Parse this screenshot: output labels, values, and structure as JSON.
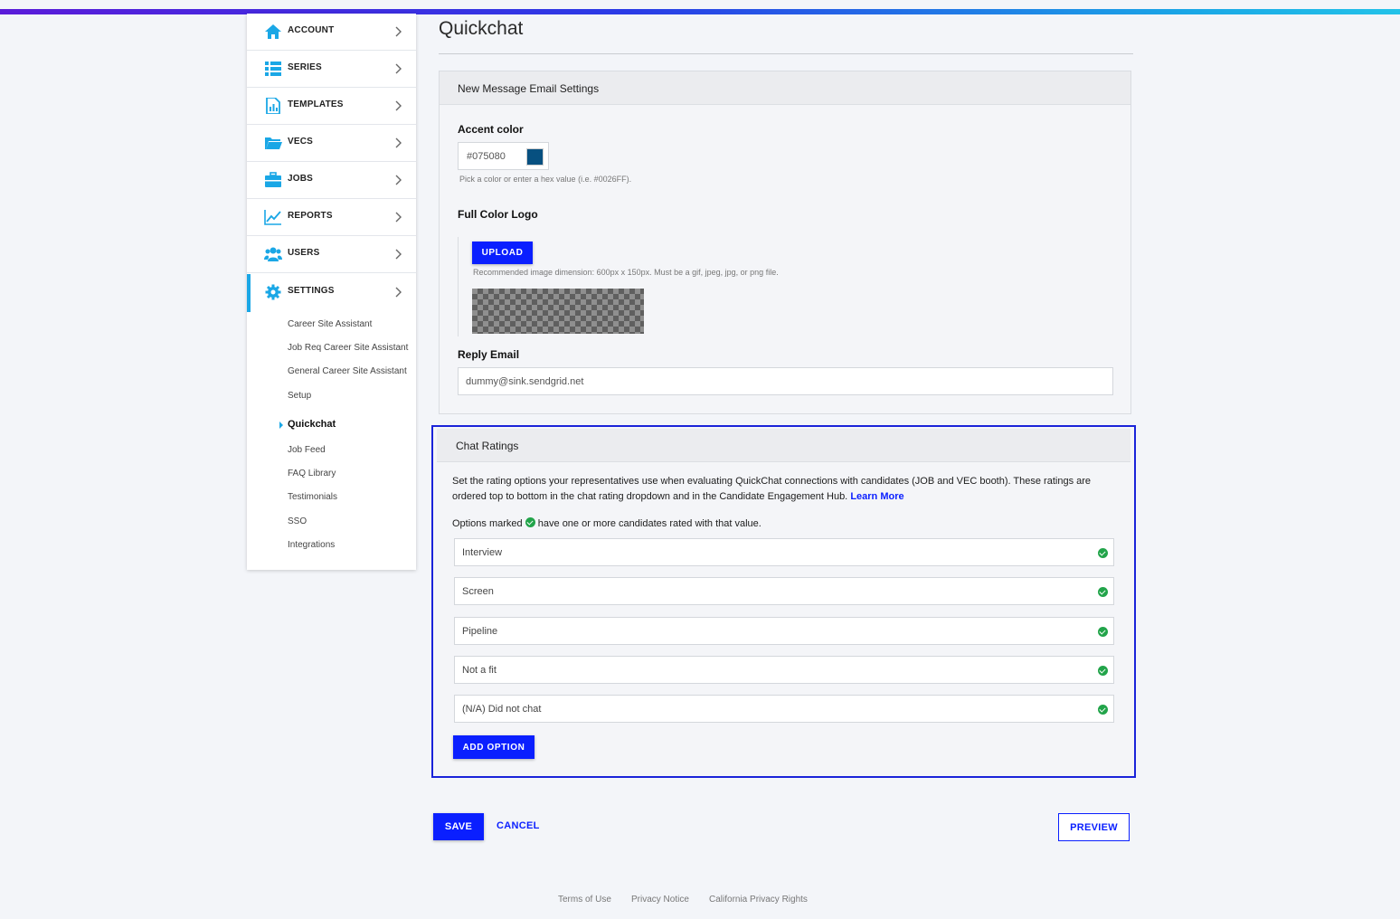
{
  "colors": {
    "brand_blue": "#0a1fff",
    "sidebar_accent": "#1aa7e6",
    "accent_swatch": "#075080",
    "success_green": "#22a44a"
  },
  "sidebar": {
    "items": [
      {
        "label": "ACCOUNT",
        "icon": "home-icon"
      },
      {
        "label": "SERIES",
        "icon": "list-icon"
      },
      {
        "label": "TEMPLATES",
        "icon": "document-chart-icon"
      },
      {
        "label": "VECS",
        "icon": "folder-icon"
      },
      {
        "label": "JOBS",
        "icon": "briefcase-icon"
      },
      {
        "label": "REPORTS",
        "icon": "chart-line-icon"
      },
      {
        "label": "USERS",
        "icon": "users-icon"
      },
      {
        "label": "SETTINGS",
        "icon": "gear-icon"
      }
    ],
    "settings_subitems": [
      "Career Site Assistant",
      "Job Req Career Site Assistant",
      "General Career Site Assistant",
      "Setup",
      "Quickchat",
      "Job Feed",
      "FAQ Library",
      "Testimonials",
      "SSO",
      "Integrations"
    ]
  },
  "page": {
    "title": "Quickchat"
  },
  "email_settings": {
    "heading": "New Message Email Settings",
    "accent_label": "Accent color",
    "accent_value": "#075080",
    "accent_hint": "Pick a color or enter a hex value (i.e. #0026FF).",
    "logo_label": "Full Color Logo",
    "upload_button": "UPLOAD",
    "logo_hint": "Recommended image dimension: 600px x 150px. Must be a gif, jpeg, jpg, or png file.",
    "reply_label": "Reply Email",
    "reply_value": "dummy@sink.sendgrid.net"
  },
  "chat_ratings": {
    "heading": "Chat Ratings",
    "description": "Set the rating options your representatives use when evaluating QuickChat connections with candidates (JOB and VEC booth). These ratings are ordered top to bottom in the chat rating dropdown and in the Candidate Engagement Hub.",
    "learn_more": "Learn More",
    "marked_prefix": "Options marked",
    "marked_suffix": "have one or more candidates rated with that value.",
    "options": [
      "Interview",
      "Screen",
      "Pipeline",
      "Not a fit",
      "(N/A) Did not chat"
    ],
    "add_option": "ADD OPTION"
  },
  "actions": {
    "save": "SAVE",
    "cancel": "CANCEL",
    "preview": "PREVIEW"
  },
  "footer": {
    "links": [
      "Terms of Use",
      "Privacy Notice",
      "California Privacy Rights"
    ]
  }
}
